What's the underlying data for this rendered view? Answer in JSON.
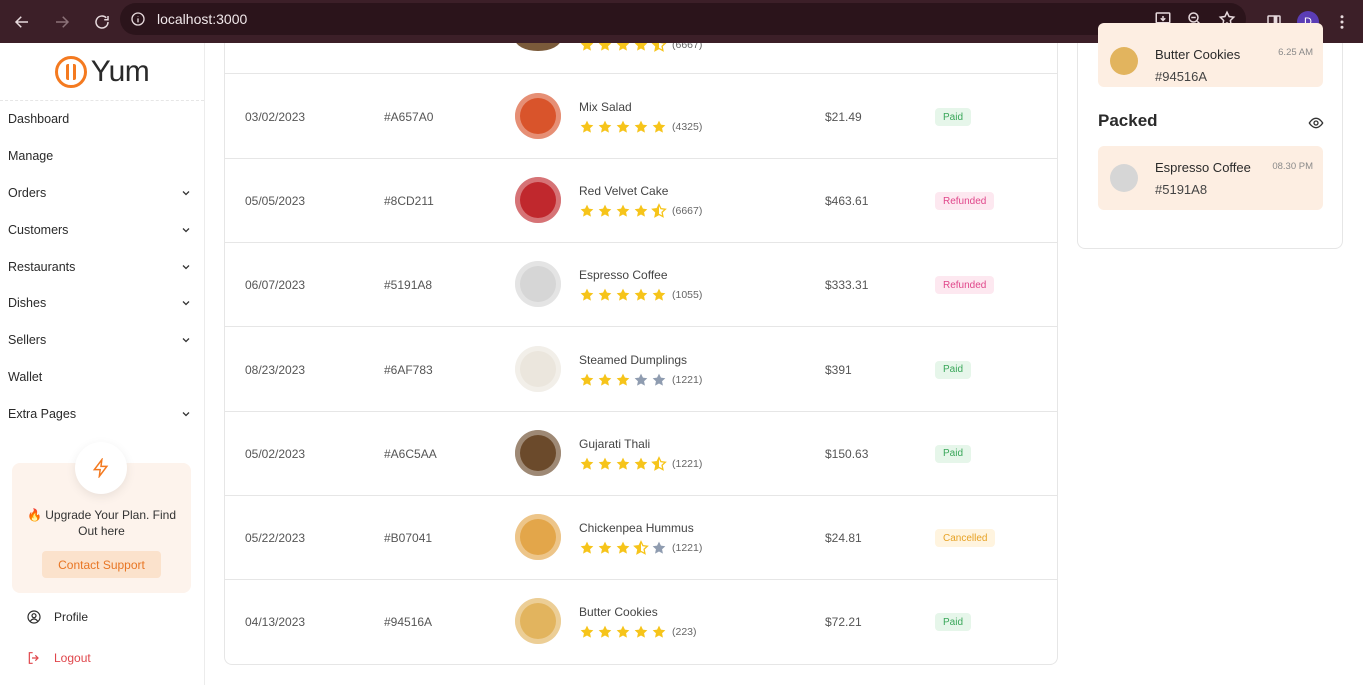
{
  "browser": {
    "url": "localhost:3000",
    "profile_initial": "D"
  },
  "sidebar": {
    "logo_text": "Yum",
    "items": [
      {
        "label": "Dashboard",
        "has_chevron": false
      },
      {
        "label": "Manage",
        "has_chevron": false
      },
      {
        "label": "Orders",
        "has_chevron": true
      },
      {
        "label": "Customers",
        "has_chevron": true
      },
      {
        "label": "Restaurants",
        "has_chevron": true
      },
      {
        "label": "Dishes",
        "has_chevron": true
      },
      {
        "label": "Sellers",
        "has_chevron": true
      },
      {
        "label": "Wallet",
        "has_chevron": false
      },
      {
        "label": "Extra Pages",
        "has_chevron": true
      }
    ],
    "upgrade": {
      "text": "🔥 Upgrade Your Plan. Find Out here",
      "button": "Contact Support"
    },
    "profile_label": "Profile",
    "logout_label": "Logout"
  },
  "partial_row": {
    "reviews": "(6667)"
  },
  "orders": [
    {
      "date": "03/02/2023",
      "id": "#A657A0",
      "dish": "Mix Salad",
      "rating": 5,
      "reviews": "(4325)",
      "price": "$21.49",
      "status": "Paid",
      "status_type": "paid",
      "thumb_color": "#d9542b"
    },
    {
      "date": "05/05/2023",
      "id": "#8CD211",
      "dish": "Red Velvet Cake",
      "rating": 4.5,
      "reviews": "(6667)",
      "price": "$463.61",
      "status": "Refunded",
      "status_type": "refunded",
      "thumb_color": "#c0282d"
    },
    {
      "date": "06/07/2023",
      "id": "#5191A8",
      "dish": "Espresso Coffee",
      "rating": 5,
      "reviews": "(1055)",
      "price": "$333.31",
      "status": "Refunded",
      "status_type": "refunded",
      "thumb_color": "#d6d6d6"
    },
    {
      "date": "08/23/2023",
      "id": "#6AF783",
      "dish": "Steamed Dumplings",
      "rating": 3,
      "reviews": "(1221)",
      "price": "$391",
      "status": "Paid",
      "status_type": "paid",
      "thumb_color": "#ebe6dd"
    },
    {
      "date": "05/02/2023",
      "id": "#A6C5AA",
      "dish": "Gujarati Thali",
      "rating": 4.5,
      "reviews": "(1221)",
      "price": "$150.63",
      "status": "Paid",
      "status_type": "paid",
      "thumb_color": "#6b4a2b"
    },
    {
      "date": "05/22/2023",
      "id": "#B07041",
      "dish": "Chickenpea Hummus",
      "rating": 3.5,
      "reviews": "(1221)",
      "price": "$24.81",
      "status": "Cancelled",
      "status_type": "cancelled",
      "thumb_color": "#e3a64a"
    },
    {
      "date": "04/13/2023",
      "id": "#94516A",
      "dish": "Butter Cookies",
      "rating": 5,
      "reviews": "(223)",
      "price": "$72.21",
      "status": "Paid",
      "status_type": "paid",
      "thumb_color": "#e2b45e"
    }
  ],
  "right_panel": {
    "top_order": {
      "name": "Butter Cookies",
      "id": "#94516A",
      "time": "6.25 AM"
    },
    "packed_title": "Packed",
    "packed_order": {
      "name": "Espresso Coffee",
      "id": "#5191A8",
      "time": "08.30 PM"
    }
  },
  "colors": {
    "star": "#f6c41a",
    "star_empty": "#8f9cb0",
    "accent": "#f47a20"
  }
}
